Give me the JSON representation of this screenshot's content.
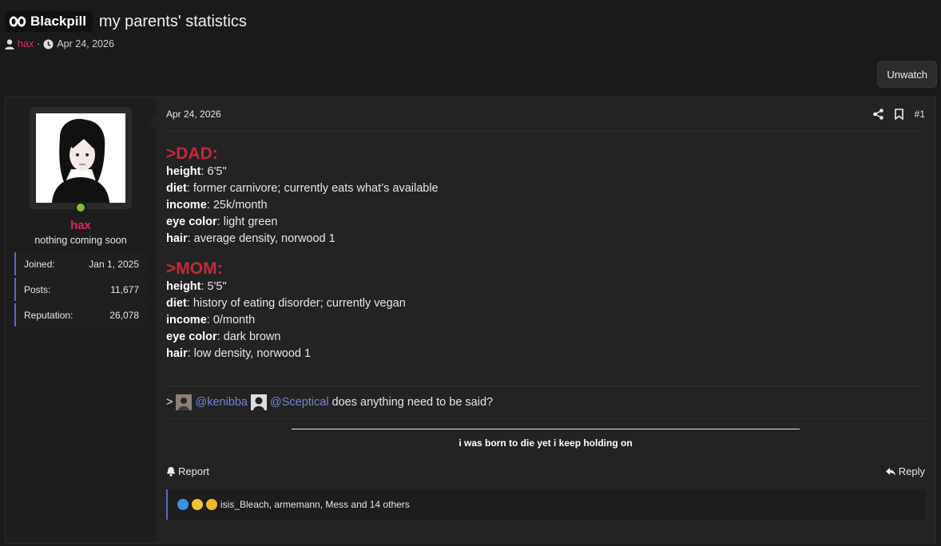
{
  "thread": {
    "prefix": "Blackpill",
    "prefix_icon": "blackpill-icon",
    "title": "my parents' statistics",
    "author": "hax",
    "date": "Apr 24, 2026",
    "separator": "·"
  },
  "unwatch_label": "Unwatch",
  "user": {
    "name": "hax",
    "title": "nothing coming soon",
    "online": true,
    "stats": [
      {
        "label": "Joined:",
        "value": "Jan 1, 2025"
      },
      {
        "label": "Posts:",
        "value": "11,677"
      },
      {
        "label": "Reputation:",
        "value": "26,078"
      }
    ]
  },
  "post": {
    "date": "Apr 24, 2026",
    "number": "#1",
    "dad": {
      "heading": ">DAD:",
      "fields": [
        {
          "key": "height",
          "value": ": 6'5\""
        },
        {
          "key": "diet",
          "value": ": former carnivore; currently eats what’s available"
        },
        {
          "key": "income",
          "value": ": 25k/month"
        },
        {
          "key": "eye color",
          "value": ": light green"
        },
        {
          "key": "hair",
          "value": ": average density, norwood 1"
        }
      ]
    },
    "mom": {
      "heading": ">MOM:",
      "fields": [
        {
          "key": "height",
          "value": ": 5'5\""
        },
        {
          "key": "diet",
          "value": ": history of eating disorder; currently vegan"
        },
        {
          "key": "income",
          "value": ": 0/month"
        },
        {
          "key": "eye color",
          "value": ": dark brown"
        },
        {
          "key": "hair",
          "value": ": low density, norwood 1"
        }
      ]
    },
    "mention_prefix": ">",
    "mention_1": "@kenibba",
    "mention_2": "@Sceptical",
    "mention_suffix": "does anything need to be said?",
    "signature": "i was born to die yet i keep holding on",
    "report_label": "Report",
    "reply_label": "Reply",
    "reactions_text": "isis_Bleach, armemann, Mess and 14 others"
  },
  "colors": {
    "accent_username": "#e0245e",
    "heading_red": "#c22b3b",
    "mention_blue": "#7884d4",
    "online_green": "#7cc12f"
  }
}
